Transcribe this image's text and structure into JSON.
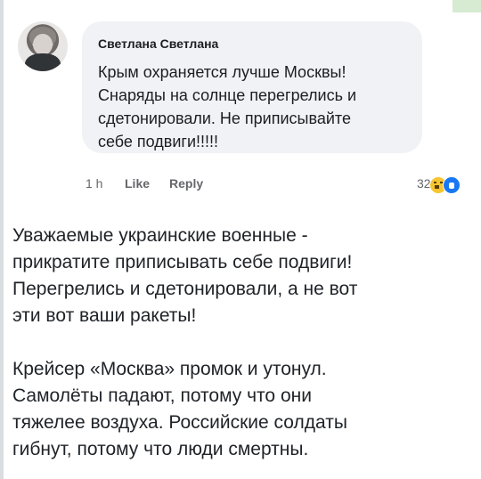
{
  "comment": {
    "author": "Светлана Светлана",
    "text": "Крым охраняется лучше Москвы!\nСнаряды на солнце перегрелись и\nсдетонировали. Не приписывайте\nсебе подвиги!!!!!",
    "time": "1 h",
    "like_label": "Like",
    "reply_label": "Reply",
    "reaction_count": "32",
    "reactions": [
      "haha-reaction-icon",
      "like-reaction-icon"
    ]
  },
  "message": {
    "paragraph1": "Уважаемые украинские военные -\nприкратите приписывать себе подвиги!\nПерегрелись и сдетонировали, а не вот\nэти вот ваши ракеты!",
    "paragraph2": "Крейсер «Москва» промок и утонул.\nСамолёты падают, потому что они\nтяжелее воздуха. Российские солдаты\nгибнут, потому что люди смертны."
  },
  "colors": {
    "bubble": "#f0f2f5",
    "text": "#1c1e21",
    "meta": "#65676b",
    "like_blue": "#1877f2",
    "haha_yellow": "#f7c531"
  }
}
